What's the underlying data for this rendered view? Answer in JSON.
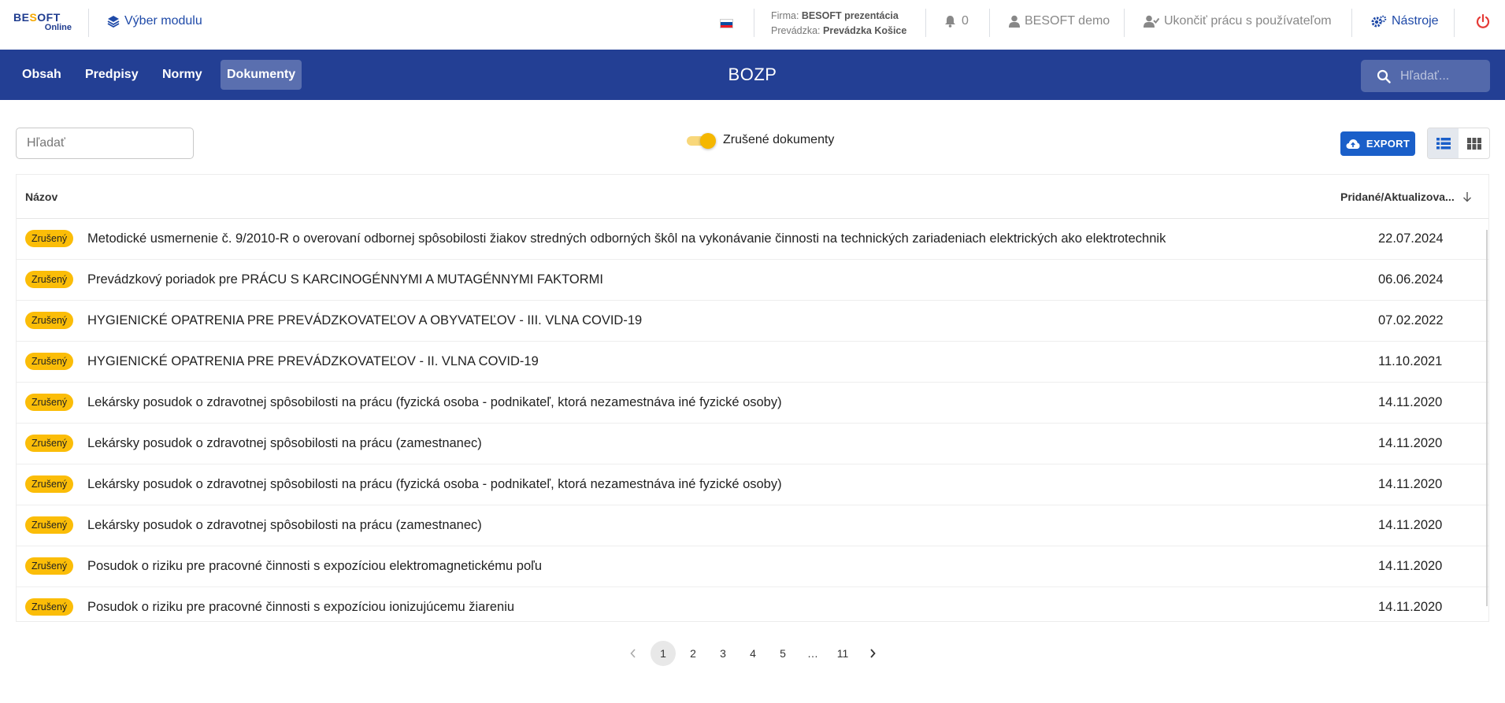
{
  "header": {
    "logo": {
      "line1_a": "BE",
      "line1_o": "S",
      "line1_b": "OFT",
      "line2": "Online"
    },
    "module_selector": "Výber modulu",
    "firm_label": "Firma:",
    "firm_value": "BESOFT prezentácia",
    "branch_label": "Prevádzka:",
    "branch_value": "Prevádzka Košice",
    "notifications_count": "0",
    "user_name": "BESOFT demo",
    "end_work": "Ukončiť prácu s používateľom",
    "tools": "Nástroje"
  },
  "nav": {
    "tabs": [
      {
        "label": "Obsah"
      },
      {
        "label": "Predpisy"
      },
      {
        "label": "Normy"
      },
      {
        "label": "Dokumenty"
      }
    ],
    "active_tab": "Dokumenty",
    "title": "BOZP",
    "search_placeholder": "Hľadať..."
  },
  "toolbar": {
    "search_placeholder": "Hľadať",
    "toggle_label": "Zrušené dokumenty",
    "export_label": "EXPORT"
  },
  "table": {
    "col_name": "Názov",
    "col_date": "Pridané/Aktualizova...",
    "rows": [
      {
        "badge": "Zrušený",
        "name": "Metodické usmernenie č. 9/2010-R o overovaní odbornej spôsobilosti žiakov stredných odborných škôl na vykonávanie činnosti na technických zariadeniach elektrických ako elektrotechnik",
        "date": "22.07.2024"
      },
      {
        "badge": "Zrušený",
        "name": "Prevádzkový poriadok pre PRÁCU S KARCINOGÉNNYMI A MUTAGÉNNYMI FAKTORMI",
        "date": "06.06.2024"
      },
      {
        "badge": "Zrušený",
        "name": "HYGIENICKÉ OPATRENIA PRE PREVÁDZKOVATEĽOV A OBYVATEĽOV - III. VLNA COVID-19",
        "date": "07.02.2022"
      },
      {
        "badge": "Zrušený",
        "name": "HYGIENICKÉ OPATRENIA PRE PREVÁDZKOVATEĽOV - II. VLNA COVID-19",
        "date": "11.10.2021"
      },
      {
        "badge": "Zrušený",
        "name": "Lekársky posudok o zdravotnej spôsobilosti na prácu (fyzická osoba - podnikateľ, ktorá nezamestnáva iné fyzické osoby)",
        "date": "14.11.2020"
      },
      {
        "badge": "Zrušený",
        "name": "Lekársky posudok o zdravotnej spôsobilosti na prácu (zamestnanec)",
        "date": "14.11.2020"
      },
      {
        "badge": "Zrušený",
        "name": "Lekársky posudok o zdravotnej spôsobilosti na prácu (fyzická osoba - podnikateľ, ktorá nezamestnáva iné fyzické osoby)",
        "date": "14.11.2020"
      },
      {
        "badge": "Zrušený",
        "name": "Lekársky posudok o zdravotnej spôsobilosti na prácu (zamestnanec)",
        "date": "14.11.2020"
      },
      {
        "badge": "Zrušený",
        "name": "Posudok o riziku pre pracovné činnosti s expozíciou elektromagnetickému poľu",
        "date": "14.11.2020"
      },
      {
        "badge": "Zrušený",
        "name": "Posudok o riziku pre pracovné činnosti s expozíciou ionizujúcemu žiareniu",
        "date": "14.11.2020"
      }
    ]
  },
  "pagination": {
    "pages": [
      "1",
      "2",
      "3",
      "4",
      "5",
      "…",
      "11"
    ],
    "current": "1"
  },
  "colors": {
    "nav_bg": "#233f94",
    "accent": "#1a5fc9",
    "badge": "#fbbd08",
    "toggle": "#f5b700"
  }
}
